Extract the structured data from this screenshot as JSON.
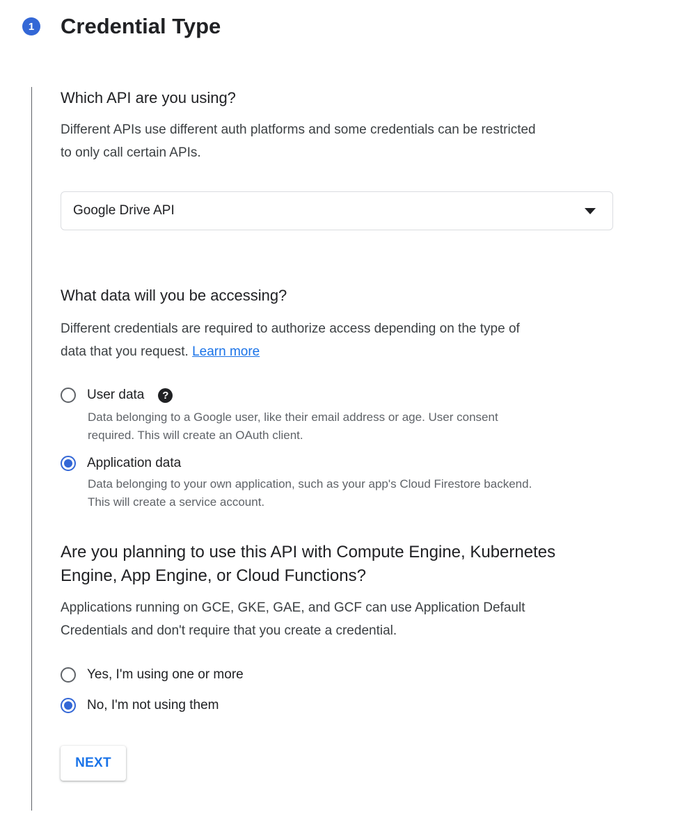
{
  "step": {
    "number": "1",
    "title": "Credential Type"
  },
  "api_section": {
    "heading": "Which API are you using?",
    "description_line1": "Different APIs use different auth platforms and some credentials can be restricted",
    "description_line2": "to only call certain APIs.",
    "selected_api": "Google Drive API"
  },
  "data_section": {
    "heading": "What data will you be accessing?",
    "description_line1": "Different credentials are required to authorize access depending on the type of",
    "description_line2": "data that you request.",
    "learn_more": "Learn more",
    "help_icon_glyph": "?",
    "options": [
      {
        "label": "User data",
        "checked": false,
        "sub_line1": "Data belonging to a Google user, like their email address or age. User consent",
        "sub_line2": "required. This will create an OAuth client."
      },
      {
        "label": "Application data",
        "checked": true,
        "sub_line1": "Data belonging to your own application, such as your app's Cloud Firestore backend.",
        "sub_line2": "This will create a service account."
      }
    ]
  },
  "compute_section": {
    "heading_line1": "Are you planning to use this API with Compute Engine, Kubernetes",
    "heading_line2": "Engine, App Engine, or Cloud Functions?",
    "description_line1": "Applications running on GCE, GKE, GAE, and GCF can use Application Default",
    "description_line2": "Credentials and don't require that you create a credential.",
    "options": [
      {
        "label": "Yes, I'm using one or more",
        "checked": false
      },
      {
        "label": "No, I'm not using them",
        "checked": true
      }
    ]
  },
  "next_button": "NEXT",
  "colors": {
    "accent": "#3367d6",
    "link": "#1a73e8",
    "text": "#202124",
    "secondary_text": "#5f6368"
  },
  "icons": {
    "dropdown": "caret-down-icon",
    "help": "help-circle-icon"
  }
}
